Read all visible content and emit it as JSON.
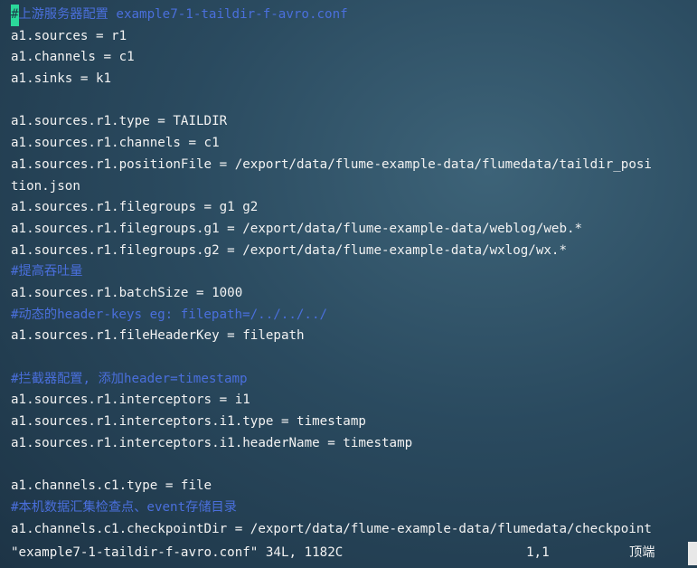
{
  "editor": {
    "first_line_cursor_char": "#",
    "first_line_rest": "上游服务器配置 example7-1-taildir-f-avro.conf",
    "lines": [
      {
        "text": "a1.sources = r1",
        "kind": "code"
      },
      {
        "text": "a1.channels = c1",
        "kind": "code"
      },
      {
        "text": "a1.sinks = k1",
        "kind": "code"
      },
      {
        "text": "",
        "kind": "code"
      },
      {
        "text": "a1.sources.r1.type = TAILDIR",
        "kind": "code"
      },
      {
        "text": "a1.sources.r1.channels = c1",
        "kind": "code"
      },
      {
        "text": "a1.sources.r1.positionFile = /export/data/flume-example-data/flumedata/taildir_posi",
        "kind": "code"
      },
      {
        "text": "tion.json",
        "kind": "code"
      },
      {
        "text": "a1.sources.r1.filegroups = g1 g2",
        "kind": "code"
      },
      {
        "text": "a1.sources.r1.filegroups.g1 = /export/data/flume-example-data/weblog/web.*",
        "kind": "code"
      },
      {
        "text": "a1.sources.r1.filegroups.g2 = /export/data/flume-example-data/wxlog/wx.*",
        "kind": "code"
      },
      {
        "text": "#提高吞吐量",
        "kind": "comment"
      },
      {
        "text": "a1.sources.r1.batchSize = 1000",
        "kind": "code"
      },
      {
        "text": "#动态的header-keys eg: filepath=/../../../",
        "kind": "comment"
      },
      {
        "text": "a1.sources.r1.fileHeaderKey = filepath",
        "kind": "code"
      },
      {
        "text": "",
        "kind": "code"
      },
      {
        "text": "#拦截器配置, 添加header=timestamp",
        "kind": "comment"
      },
      {
        "text": "a1.sources.r1.interceptors = i1",
        "kind": "code"
      },
      {
        "text": "a1.sources.r1.interceptors.i1.type = timestamp",
        "kind": "code"
      },
      {
        "text": "a1.sources.r1.interceptors.i1.headerName = timestamp",
        "kind": "code"
      },
      {
        "text": "",
        "kind": "code"
      },
      {
        "text": "a1.channels.c1.type = file",
        "kind": "code"
      },
      {
        "text": "#本机数据汇集检查点、event存储目录",
        "kind": "comment"
      },
      {
        "text": "a1.channels.c1.checkpointDir = /export/data/flume-example-data/flumedata/checkpoint",
        "kind": "code"
      }
    ]
  },
  "status": {
    "file_info": "\"example7-1-taildir-f-avro.conf\" 34L, 1182C",
    "cursor_pos": "1,1",
    "scroll_pos": "顶端"
  },
  "colors": {
    "code_text": "#f2f2f2",
    "comment_text": "#4a6fdc",
    "cursor": "#2bd89a",
    "background": "#2a4a5f"
  }
}
